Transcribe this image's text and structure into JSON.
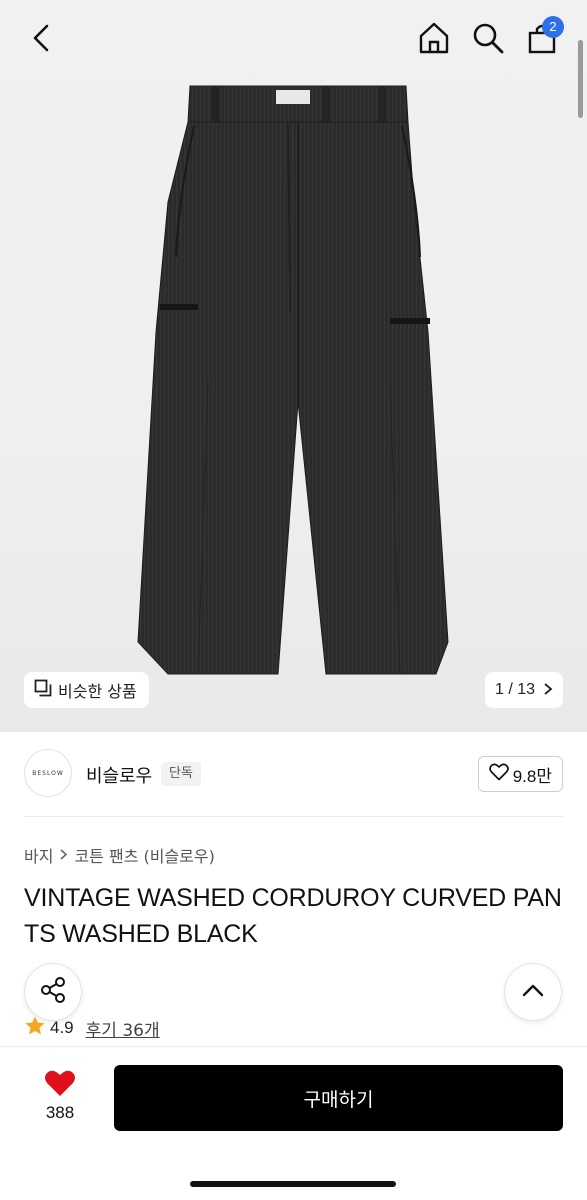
{
  "header": {
    "back_icon": "chevron-left-icon",
    "home_icon": "home-icon",
    "search_icon": "search-icon",
    "cart_icon": "shopping-bag-icon",
    "cart_count": "2",
    "badge_color": "#2f6fea"
  },
  "gallery": {
    "similar_label": "비슷한 상품",
    "page_indicator": "1 / 13",
    "product_image": "black corduroy wide pants"
  },
  "brand": {
    "logo_text": "BESLOW",
    "name": "비슬로우",
    "tag": "단독",
    "likes": "9.8만"
  },
  "breadcrumb": {
    "category": "바지",
    "subcategory": "코튼 팬츠 (비슬로우)"
  },
  "product": {
    "title": "VINTAGE WASHED CORDUROY CURVED PANTS WASHED BLACK",
    "rating": "4.9",
    "reviews": "후기 36개"
  },
  "actions": {
    "share_icon": "share-icon",
    "scroll_top_icon": "chevron-up-icon"
  },
  "bottom_bar": {
    "wish_count": "388",
    "wish_color": "#e0101b",
    "buy_label": "구매하기"
  }
}
